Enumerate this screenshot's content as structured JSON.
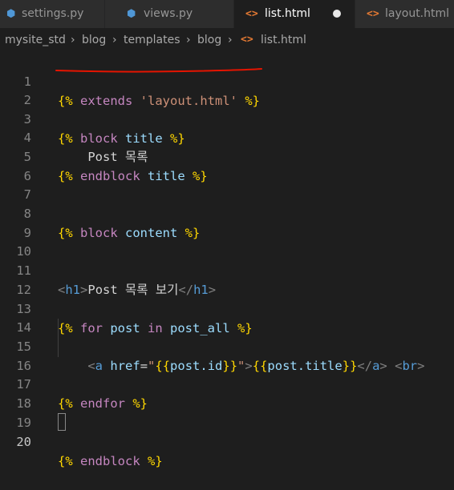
{
  "tabs": [
    {
      "label": "settings.py",
      "icon": "python-icon",
      "active": false
    },
    {
      "label": "views.py",
      "icon": "python-icon",
      "active": false
    },
    {
      "label": "list.html",
      "icon": "html-icon",
      "active": true,
      "unsaved": true
    },
    {
      "label": "layout.html",
      "icon": "html-icon",
      "active": false
    }
  ],
  "breadcrumb": [
    "mysite_std",
    "blog",
    "templates",
    "blog",
    "list.html"
  ],
  "line_numbers": [
    "1",
    "2",
    "3",
    "4",
    "5",
    "6",
    "7",
    "8",
    "9",
    "10",
    "11",
    "12",
    "13",
    "14",
    "15",
    "16",
    "17",
    "18",
    "19",
    "20"
  ],
  "code": {
    "l1": [
      "{%",
      " extends ",
      "'layout.html'",
      " %}"
    ],
    "l3": [
      "{%",
      " block ",
      "title",
      " %}"
    ],
    "l4": [
      "    Post 목록"
    ],
    "l5": [
      "{%",
      " endblock ",
      "title",
      " %}"
    ],
    "l8": [
      "{%",
      " block ",
      "content",
      " %}"
    ],
    "l11": [
      "<",
      "h1",
      ">",
      "Post 목록 보기",
      "</",
      "h1",
      ">"
    ],
    "l13": [
      "{%",
      " for ",
      "post",
      " in ",
      "post_all",
      " %}"
    ],
    "l15": [
      "    ",
      "<",
      "a",
      " ",
      "href",
      "=",
      "\"",
      "{{",
      "post.id",
      "}}",
      "\"",
      ">",
      "{{",
      "post.title",
      "}}",
      "</",
      "a",
      ">",
      " ",
      "<",
      "br",
      ">"
    ],
    "l17": [
      "{%",
      " endfor ",
      "%}"
    ],
    "l20": [
      "{%",
      " endblock ",
      "%}"
    ]
  },
  "colors": {
    "editor_bg": "#1e1e1e",
    "template_brace": "#ffd700",
    "keyword": "#c586c0",
    "variable": "#9cdcfe",
    "string": "#ce9178",
    "html_tag": "#569cd6",
    "annotation_underline": "#e51400"
  }
}
